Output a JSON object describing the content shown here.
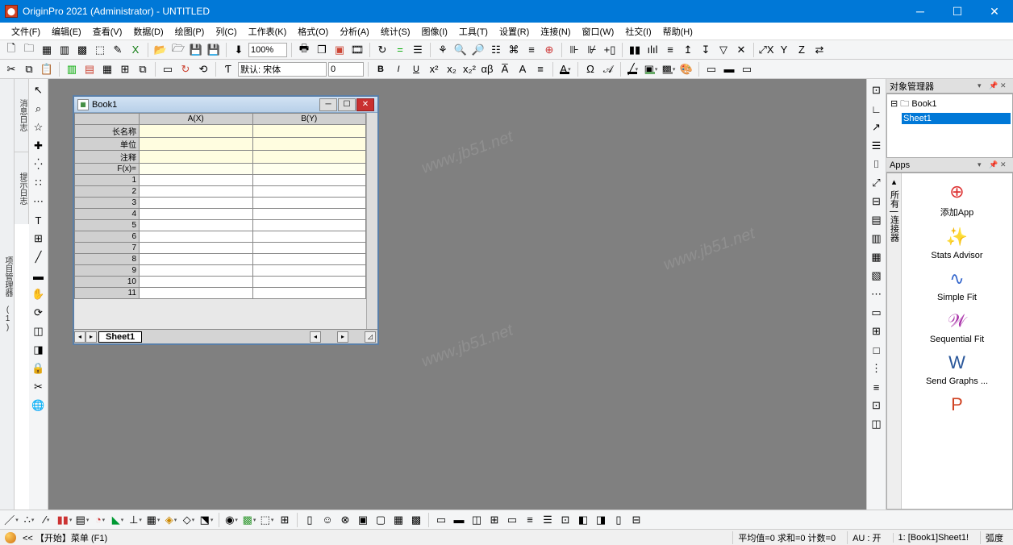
{
  "window": {
    "title": "OriginPro 2021 (Administrator) - UNTITLED"
  },
  "menu": [
    "文件(F)",
    "编辑(E)",
    "查看(V)",
    "数据(D)",
    "绘图(P)",
    "列(C)",
    "工作表(K)",
    "格式(O)",
    "分析(A)",
    "统计(S)",
    "图像(I)",
    "工具(T)",
    "设置(R)",
    "连接(N)",
    "窗口(W)",
    "社交(I)",
    "帮助(H)"
  ],
  "toolbar1": {
    "zoom": "100%"
  },
  "toolbar2": {
    "font": "默认: 宋体",
    "size": "0"
  },
  "book": {
    "title": "Book1",
    "cols": [
      "A(X)",
      "B(Y)"
    ],
    "rowHeaders": [
      "长名称",
      "单位",
      "注释",
      "F(x)="
    ],
    "rows": [
      1,
      2,
      3,
      4,
      5,
      6,
      7,
      8,
      9,
      10,
      11
    ],
    "sheetTab": "Sheet1"
  },
  "objMgr": {
    "title": "对象管理器",
    "root": "Book1",
    "child": "Sheet1"
  },
  "appsPane": {
    "title": "Apps",
    "side": "所有 | 连接器",
    "items": [
      {
        "label": "添加App",
        "icon": "add"
      },
      {
        "label": "Stats Advisor",
        "icon": "wand"
      },
      {
        "label": "Simple Fit",
        "icon": "fit"
      },
      {
        "label": "Sequential Fit",
        "icon": "seq"
      },
      {
        "label": "Send Graphs ...",
        "icon": "word"
      }
    ]
  },
  "sideTabs": {
    "left1": "项目管理器 (1)",
    "left2": "消息日志",
    "left3": "提示日志"
  },
  "status": {
    "hint": "<<  【开始】菜单 (F1)",
    "avg": "平均值=0 求和=0 计数=0",
    "au": "AU : 开",
    "sheet": "1: [Book1]Sheet1!",
    "mode": "弧度"
  }
}
